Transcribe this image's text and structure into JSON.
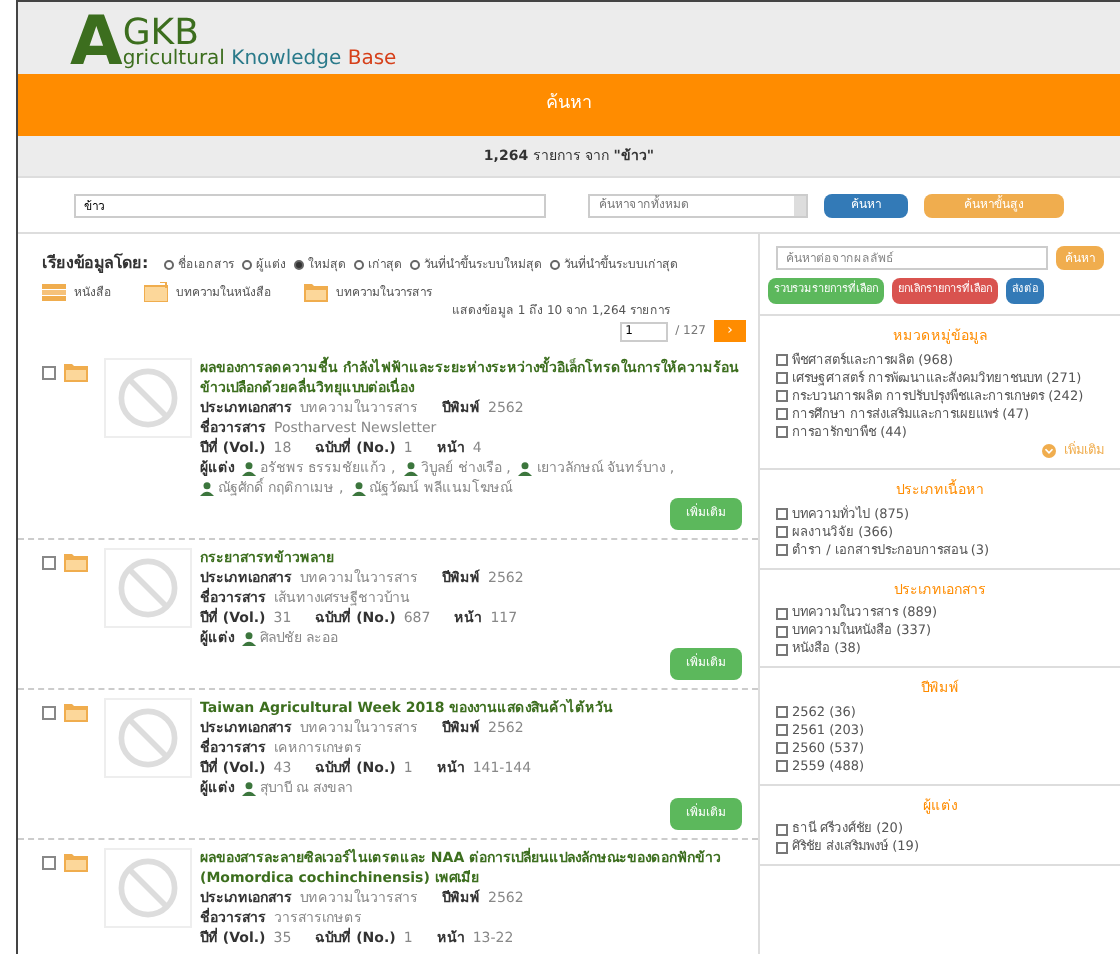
{
  "logo": {
    "initial": "A",
    "acronym_rest": "GKB",
    "words": [
      "gricultural",
      "Knowledge",
      "Base"
    ]
  },
  "banner": {
    "title": "ค้นหา"
  },
  "summary": {
    "count": "1,264",
    "text": "รายการ จาก",
    "query": "\"ข้าว\""
  },
  "search": {
    "value": "ข้าว",
    "scope": "ค้นหาจากทั้งหมด",
    "buttons": [
      {
        "label": "ค้นหา",
        "kind": "primary"
      },
      {
        "label": "ค้นหาขั้นสูง",
        "kind": "warning"
      }
    ]
  },
  "sort": {
    "label": "เรียงข้อมูลโดย:",
    "options": [
      {
        "label": "ชื่อเอกสาร",
        "selected": false
      },
      {
        "label": "ผู้แต่ง",
        "selected": false
      },
      {
        "label": "ใหม่สุด",
        "selected": true
      },
      {
        "label": "เก่าสุด",
        "selected": false
      },
      {
        "label": "วันที่นำขึ้นระบบใหม่สุด",
        "selected": false
      },
      {
        "label": "วันที่นำขึ้นระบบเก่าสุด",
        "selected": false
      }
    ]
  },
  "legend": [
    {
      "label": "หนังสือ",
      "kind": "book"
    },
    {
      "label": "บทความในหนังสือ",
      "kind": "chapter"
    },
    {
      "label": "บทความในวารสาร",
      "kind": "article"
    }
  ],
  "paging": {
    "info": "แสดงข้อมูล 1 ถึง 10 จาก 1,264 รายการ",
    "page": "1",
    "total": "/ 127",
    "next": "›"
  },
  "results": [
    {
      "title": "ผลของการลดความชื้น กำลังไฟฟ้าและระยะห่างระหว่างขั้วอิเล็กโทรดในการให้ความร้อนข้าวเปลือกด้วยคลื่นวิทยุแบบต่อเนื่อง",
      "type_label": "ประเภทเอกสาร",
      "type": "บทความในวารสาร",
      "year_label": "ปีพิมพ์",
      "year": "2562",
      "journal_label": "ชื่อวารสาร",
      "journal": "Postharvest Newsletter",
      "vol_label": "ปีที่ (Vol.)",
      "vol": "18",
      "no_label": "ฉบับที่ (No.)",
      "no": "1",
      "page_label": "หน้า",
      "pages": "4",
      "authors_label": "ผู้แต่ง",
      "authors": [
        "อรัชพร ธรรมชัยแก้ว ,",
        "วิบูลย์ ช่างเรือ ,",
        "เยาวลักษณ์ จันทร์บาง ,",
        "ณัฐศักดิ์ กฤติกาเมษ ,",
        "ณัฐวัฒน์ พลีแนมโฆษณ์"
      ],
      "more": "เพิ่มเติม",
      "checked": false
    },
    {
      "title": "กระยาสารทข้าวพลาย",
      "type_label": "ประเภทเอกสาร",
      "type": "บทความในวารสาร",
      "year_label": "ปีพิมพ์",
      "year": "2562",
      "journal_label": "ชื่อวารสาร",
      "journal": "เส้นทางเศรษฐีชาวบ้าน",
      "vol_label": "ปีที่ (Vol.)",
      "vol": "31",
      "no_label": "ฉบับที่ (No.)",
      "no": "687",
      "page_label": "หน้า",
      "pages": "117",
      "authors_label": "ผู้แต่ง",
      "authors": [
        "ศิลปชัย ละออ"
      ],
      "more": "เพิ่มเติม",
      "checked": false
    },
    {
      "title": "Taiwan Agricultural Week 2018 ของงานแสดงสินค้าไต้หวัน",
      "type_label": "ประเภทเอกสาร",
      "type": "บทความในวารสาร",
      "year_label": "ปีพิมพ์",
      "year": "2562",
      "journal_label": "ชื่อวารสาร",
      "journal": "เคหการเกษตร",
      "vol_label": "ปีที่ (Vol.)",
      "vol": "43",
      "no_label": "ฉบับที่ (No.)",
      "no": "1",
      "page_label": "หน้า",
      "pages": "141-144",
      "authors_label": "ผู้แต่ง",
      "authors": [
        "สุบาบี ณ สงขลา"
      ],
      "more": "เพิ่มเติม",
      "checked": false
    },
    {
      "title": "ผลของสารละลายซิลเวอร์ไนเตรตและ NAA ต่อการเปลี่ยนแปลงลักษณะของดอกฟักข้าว (Momordica cochinchinensis) เพศเมีย",
      "type_label": "ประเภทเอกสาร",
      "type": "บทความในวารสาร",
      "year_label": "ปีพิมพ์",
      "year": "2562",
      "journal_label": "ชื่อวารสาร",
      "journal": "วารสารเกษตร",
      "vol_label": "ปีที่ (Vol.)",
      "vol": "35",
      "no_label": "ฉบับที่ (No.)",
      "no": "1",
      "page_label": "หน้า",
      "pages": "13-22",
      "checked": false
    }
  ],
  "refine": {
    "placeholder": "ค้นหาต่อจากผลลัพธ์",
    "search": "ค้นหา",
    "actions": [
      {
        "label": "รวบรวมรายการที่เลือก",
        "kind": "success"
      },
      {
        "label": "ยกเลิกรายการที่เลือก",
        "kind": "danger"
      },
      {
        "label": "ส่งต่อ",
        "kind": "primary"
      }
    ]
  },
  "facets": [
    {
      "title": "หมวดหมู่ข้อมูล",
      "items": [
        {
          "label": "พืชศาสตร์และการผลิต (968)",
          "checked": false
        },
        {
          "label": "เศรษฐศาสตร์ การพัฒนาและสังคมวิทยาชนบท (271)",
          "checked": false
        },
        {
          "label": "กระบวนการผลิต การปรับปรุงพืชและการเกษตร (242)",
          "checked": false
        },
        {
          "label": "การศึกษา การส่งเสริมและการเผยแพร่ (47)",
          "checked": false
        },
        {
          "label": "การอารักขาพืช (44)",
          "checked": false
        }
      ],
      "more": "เพิ่มเติม"
    },
    {
      "title": "ประเภทเนื้อหา",
      "items": [
        {
          "label": "บทความทั่วไป (875)",
          "checked": false
        },
        {
          "label": "ผลงานวิจัย (366)",
          "checked": false
        },
        {
          "label": "ตำรา / เอกสารประกอบการสอน (3)",
          "checked": false
        }
      ]
    },
    {
      "title": "ประเภทเอกสาร",
      "items": [
        {
          "label": "บทความในวารสาร (889)",
          "checked": false
        },
        {
          "label": "บทความในหนังสือ (337)",
          "checked": false
        },
        {
          "label": "หนังสือ (38)",
          "checked": false
        }
      ]
    },
    {
      "title": "ปีพิมพ์",
      "items": [
        {
          "label": "2562 (36)",
          "checked": false
        },
        {
          "label": "2561 (203)",
          "checked": false
        },
        {
          "label": "2560 (537)",
          "checked": false
        },
        {
          "label": "2559 (488)",
          "checked": false
        }
      ]
    },
    {
      "title": "ผู้แต่ง",
      "items": [
        {
          "label": "ธานี ศรีวงศ์ชัย (20)",
          "checked": false
        },
        {
          "label": "ศิริชัย ส่งเสริมพงษ์ (19)",
          "checked": false
        }
      ]
    }
  ]
}
